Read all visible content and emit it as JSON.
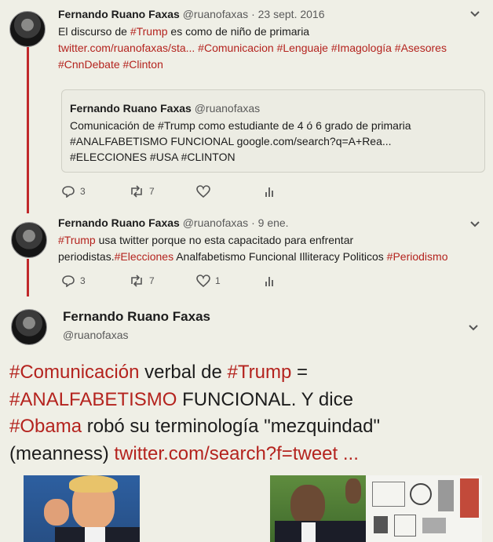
{
  "tweet1": {
    "name": "Fernando Ruano Faxas",
    "handle": "@ruanofaxas",
    "sep": " · ",
    "date": "23 sept. 2016",
    "line1_pre": "El discurso de ",
    "line1_tag": "#Trump",
    "line1_post": " es como de niño de primaria",
    "line2": "twitter.com/ruanofaxas/sta... #Comunicacion #Lenguaje #Imagología #Asesores",
    "line3": "#CnnDebate #Clinton",
    "quote": {
      "name": "Fernando Ruano Faxas",
      "handle": "@ruanofaxas",
      "line1": "Comunicación de #Trump como estudiante de 4 ó 6 grado de primaria",
      "line2": "#ANALFABETISMO FUNCIONAL google.com/search?q=A+Rea...",
      "line3": "#ELECCIONES #USA #CLINTON"
    },
    "replies": "3",
    "retweets": "7"
  },
  "tweet2": {
    "name": "Fernando Ruano Faxas",
    "handle": "@ruanofaxas",
    "sep": " · ",
    "date": "9 ene.",
    "line1_tag": "#Trump",
    "line1_post": " usa twitter porque no esta capacitado para enfrentar",
    "line2_pre": "periodistas.",
    "line2_tag1": "#Elecciones",
    "line2_mid": " Analfabetismo Funcional Illiteracy Politicos ",
    "line2_tag2": "#Periodismo",
    "replies": "3",
    "retweets": "7",
    "likes": "1"
  },
  "tweet3": {
    "name": "Fernando Ruano Faxas",
    "handle": "@ruanofaxas",
    "l1_tag": "#Comunicación",
    "l1_mid": " verbal de ",
    "l1_tag2": "#Trump",
    "l1_post": " =",
    "l2_tag": "#ANALFABETISMO",
    "l2_post": " FUNCIONAL. Y dice",
    "l3_tag": "#Obama",
    "l3_post": " robó su terminología \"mezquindad\"",
    "l4_pre": "(meanness) ",
    "l4_link": "twitter.com/search?f=tweet",
    "l4_post": " ..."
  },
  "colors": {
    "hashtag": "#b4231e",
    "thread": "#c0282b",
    "background": "#efefe6"
  },
  "icons": [
    "reply-icon",
    "retweet-icon",
    "like-icon",
    "analytics-icon",
    "chevron-down-icon"
  ]
}
